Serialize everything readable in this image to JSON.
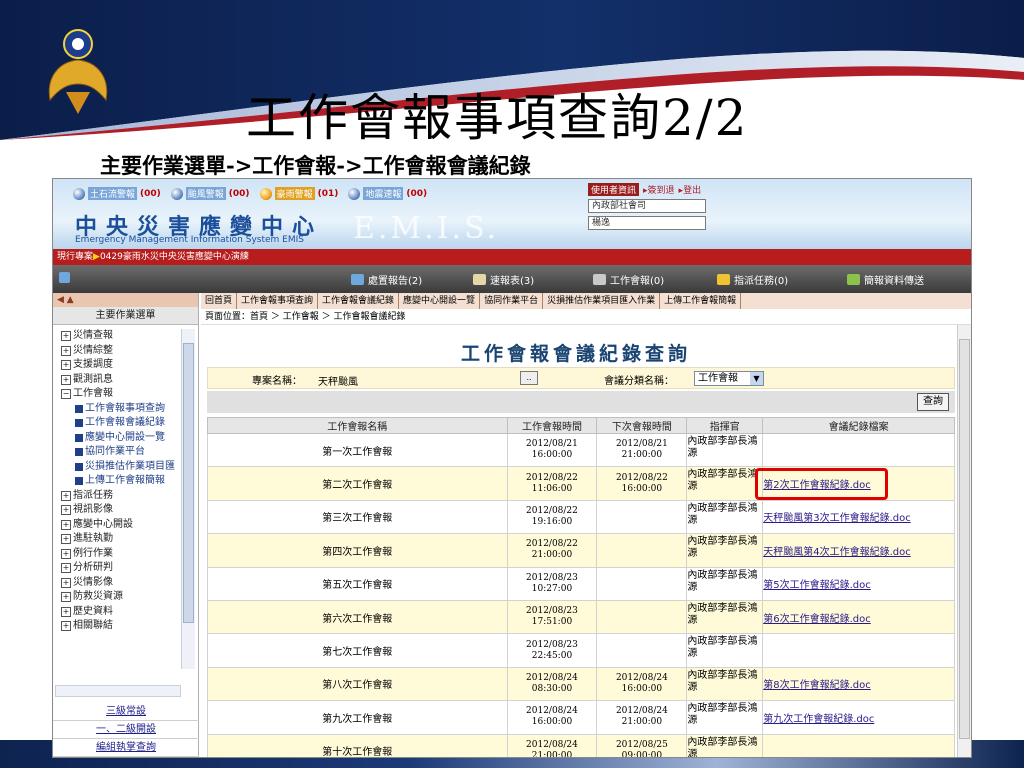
{
  "slide": {
    "title": "工作會報事項查詢2/2",
    "subtitle": "主要作業選單->工作會報->工作會報會議紀錄"
  },
  "banner": {
    "alerts": [
      {
        "label": "土石流警報",
        "count": "(00)"
      },
      {
        "label": "颱風警報",
        "count": "(00)"
      },
      {
        "label": "豪雨警報",
        "count": "(01)"
      },
      {
        "label": "地震速報",
        "count": "(00)"
      }
    ],
    "title": "中央災害應變中心",
    "subtitle_en": "Emergency Management Information System EMIS",
    "watermark": "E.M.I.S.",
    "user_label": "使用者資訊",
    "link_change": "▸簽到退",
    "link_logout": "▸登出",
    "user_org": "內政部社會司",
    "user_name": "楊逸"
  },
  "project_bar": {
    "label": "現行專案",
    "arrow": "▶",
    "value": "0429豪雨水災中央災害應變中心演練"
  },
  "toolbar": {
    "items": [
      {
        "label": "處置報告(2)",
        "icon": "report-icon"
      },
      {
        "label": "速報表(3)",
        "icon": "flash-report-icon"
      },
      {
        "label": "工作會報(0)",
        "icon": "meeting-icon"
      },
      {
        "label": "指派任務(0)",
        "icon": "task-icon"
      },
      {
        "label": "簡報資料傳送",
        "icon": "upload-icon"
      }
    ]
  },
  "left": {
    "head": "◀ ▲",
    "menu_title": "主要作業選單",
    "tree": [
      {
        "label": "災情查報",
        "type": "parent",
        "pm": "+"
      },
      {
        "label": "災情綜整",
        "type": "parent",
        "pm": "+"
      },
      {
        "label": "支援調度",
        "type": "parent",
        "pm": "+"
      },
      {
        "label": "觀測訊息",
        "type": "parent",
        "pm": "+"
      },
      {
        "label": "工作會報",
        "type": "parent",
        "pm": "−"
      },
      {
        "label": "工作會報事項查詢",
        "type": "child"
      },
      {
        "label": "工作會報會議紀錄",
        "type": "child"
      },
      {
        "label": "應變中心開設一覽",
        "type": "child"
      },
      {
        "label": "協同作業平台",
        "type": "child"
      },
      {
        "label": "災損推估作業項目匯",
        "type": "child"
      },
      {
        "label": "上傳工作會報簡報",
        "type": "child"
      },
      {
        "label": "指派任務",
        "type": "parent",
        "pm": "+"
      },
      {
        "label": "視訊影像",
        "type": "parent",
        "pm": "+"
      },
      {
        "label": "應變中心開設",
        "type": "parent",
        "pm": "+"
      },
      {
        "label": "進駐執勤",
        "type": "parent",
        "pm": "+"
      },
      {
        "label": "例行作業",
        "type": "parent",
        "pm": "+"
      },
      {
        "label": "分析研判",
        "type": "parent",
        "pm": "+"
      },
      {
        "label": "災情影像",
        "type": "parent",
        "pm": "+"
      },
      {
        "label": "防救災資源",
        "type": "parent",
        "pm": "+"
      },
      {
        "label": "歷史資料",
        "type": "parent",
        "pm": "+"
      },
      {
        "label": "相關聯結",
        "type": "parent",
        "pm": "+"
      }
    ],
    "bottom_links": [
      "三級常設",
      "一、二級開設",
      "編組執掌查詢"
    ]
  },
  "nav_tabs": [
    "回首頁",
    "工作會報事項查詢",
    "工作會報會議紀錄",
    "應變中心開設一覽",
    "協同作業平台",
    "災損推估作業項目匯入作業",
    "上傳工作會報簡報"
  ],
  "breadcrumb": "頁面位置：首頁 ＞ 工作會報 ＞ 工作會報會議紀錄",
  "content": {
    "title": "工作會報會議紀錄查詢",
    "project_label": "專案名稱：",
    "project_value": "天秤颱風",
    "browse": "..",
    "category_label": "會議分類名稱：",
    "category_value": "工作會報",
    "query_button": "查詢",
    "columns": [
      "工作會報名稱",
      "工作會報時間",
      "下次會報時間",
      "指揮官",
      "會議紀錄檔案"
    ],
    "rows": [
      {
        "name": "第一次工作會報",
        "time1": "2012/08/21",
        "time2": "16:00:00",
        "next1": "2012/08/21",
        "next2": "21:00:00",
        "cmd": "內政部李部長鴻源",
        "file": ""
      },
      {
        "name": "第二次工作會報",
        "time1": "2012/08/22",
        "time2": "11:06:00",
        "next1": "2012/08/22",
        "next2": "16:00:00",
        "cmd": "內政部李部長鴻源",
        "file": "第2次工作會報紀錄.doc"
      },
      {
        "name": "第三次工作會報",
        "time1": "2012/08/22",
        "time2": "19:16:00",
        "next1": "",
        "next2": "",
        "cmd": "內政部李部長鴻源",
        "file": "天秤颱風第3次工作會報紀錄.doc"
      },
      {
        "name": "第四次工作會報",
        "time1": "2012/08/22",
        "time2": "21:00:00",
        "next1": "",
        "next2": "",
        "cmd": "內政部李部長鴻源",
        "file": "天秤颱風第4次工作會報紀錄.doc"
      },
      {
        "name": "第五次工作會報",
        "time1": "2012/08/23",
        "time2": "10:27:00",
        "next1": "",
        "next2": "",
        "cmd": "內政部李部長鴻源",
        "file": "第5次工作會報紀錄.doc"
      },
      {
        "name": "第六次工作會報",
        "time1": "2012/08/23",
        "time2": "17:51:00",
        "next1": "",
        "next2": "",
        "cmd": "內政部李部長鴻源",
        "file": "第6次工作會報紀錄.doc"
      },
      {
        "name": "第七次工作會報",
        "time1": "2012/08/23",
        "time2": "22:45:00",
        "next1": "",
        "next2": "",
        "cmd": "內政部李部長鴻源",
        "file": ""
      },
      {
        "name": "第八次工作會報",
        "time1": "2012/08/24",
        "time2": "08:30:00",
        "next1": "2012/08/24",
        "next2": "16:00:00",
        "cmd": "內政部李部長鴻源",
        "file": "第8次工作會報紀錄.doc"
      },
      {
        "name": "第九次工作會報",
        "time1": "2012/08/24",
        "time2": "16:00:00",
        "next1": "2012/08/24",
        "next2": "21:00:00",
        "cmd": "內政部李部長鴻源",
        "file": "第九次工作會報紀錄.doc"
      },
      {
        "name": "第十次工作會報",
        "time1": "2012/08/24",
        "time2": "21:00:00",
        "next1": "2012/08/25",
        "next2": "09:00:00",
        "cmd": "內政部李部長鴻源",
        "file": ""
      }
    ]
  }
}
